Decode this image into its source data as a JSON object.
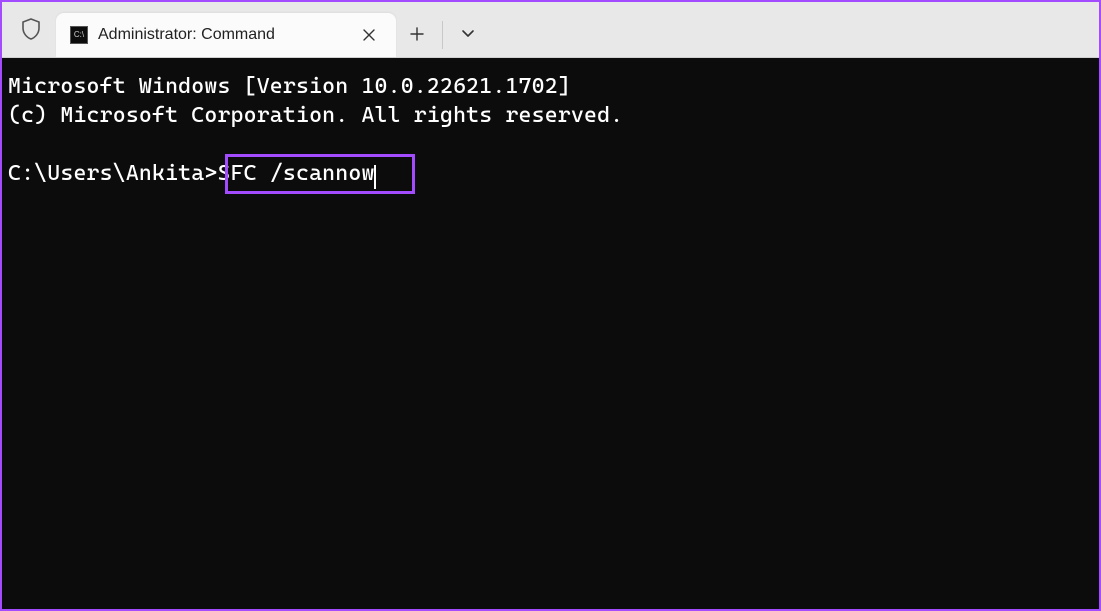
{
  "tab": {
    "title": "Administrator: Command"
  },
  "terminal": {
    "line1": "Microsoft Windows [Version 10.0.22621.1702]",
    "line2": "(c) Microsoft Corporation. All rights reserved.",
    "blank": "",
    "prompt": "C:\\Users\\Ankita>",
    "command": "SFC /scannow"
  },
  "colors": {
    "accent": "#a24bff"
  }
}
